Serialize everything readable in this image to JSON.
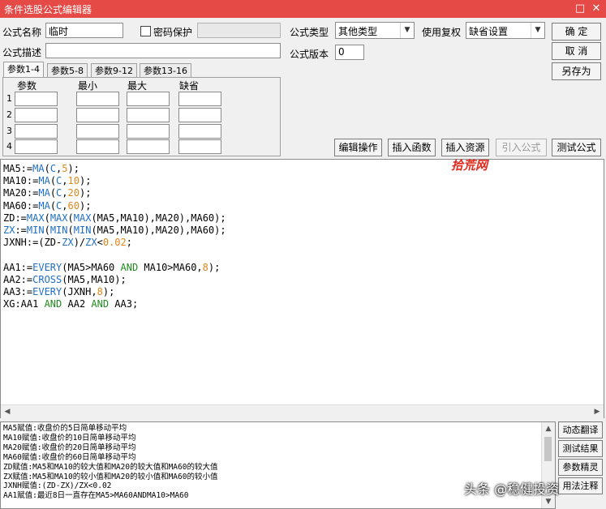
{
  "window": {
    "title": "条件选股公式编辑器",
    "min_icon": "□",
    "close_icon": "✕"
  },
  "form": {
    "name_label": "公式名称",
    "name_value": "临时",
    "password_label": "密码保护",
    "type_label": "公式类型",
    "type_value": "其他类型",
    "fq_label": "使用复权",
    "fq_value": "缺省设置",
    "desc_label": "公式描述",
    "desc_value": "",
    "version_label": "公式版本",
    "version_value": "0"
  },
  "right_buttons": {
    "ok": "确  定",
    "cancel": "取  消",
    "save_as": "另存为"
  },
  "tabs": [
    "参数1-4",
    "参数5-8",
    "参数9-12",
    "参数13-16"
  ],
  "param_headers": [
    "参数",
    "最小",
    "最大",
    "缺省"
  ],
  "param_rows": [
    "1",
    "2",
    "3",
    "4"
  ],
  "toolbar": {
    "edit_op": "编辑操作",
    "insert_func": "插入函数",
    "insert_res": "插入资源",
    "import_formula": "引入公式",
    "test_formula": "测试公式"
  },
  "watermark_top": "拾荒网",
  "code_lines": [
    "MA5:=MA(C,5);",
    "MA10:=MA(C,10);",
    "MA20:=MA(C,20);",
    "MA60:=MA(C,60);",
    "ZD:=MAX(MAX(MAX(MA5,MA10),MA20),MA60);",
    "ZX:=MIN(MIN(MIN(MA5,MA10),MA20),MA60);",
    "JXNH:=(ZD-ZX)/ZX<0.02;",
    "",
    "AA1:=EVERY(MA5>MA60 AND MA10>MA60,8);",
    "AA2:=CROSS(MA5,MA10);",
    "AA3:=EVERY(JXNH,8);",
    "XG:AA1 AND AA2 AND AA3;"
  ],
  "explain_lines": [
    "MA5赋值:收盘价的5日简单移动平均",
    "MA10赋值:收盘价的10日简单移动平均",
    "MA20赋值:收盘价的20日简单移动平均",
    "MA60赋值:收盘价的60日简单移动平均",
    "ZD赋值:MA5和MA10的较大值和MA20的较大值和MA60的较大值",
    "ZX赋值:MA5和MA10的较小值和MA20的较小值和MA60的较小值",
    "JXNH赋值:(ZD-ZX)/ZX<0.02",
    "AA1赋值:最近8日一直存在MA5>MA60ANDMA10>MA60"
  ],
  "side_buttons": {
    "translate": "动态翻译",
    "test_result": "测试结果",
    "param_tune": "参数精灵",
    "usage": "用法注释"
  },
  "footer_watermark": "头条 @稳健投资",
  "colors": {
    "titlebar": "#e64a46",
    "func": "#1f6fc5",
    "number": "#e0861a",
    "keyword": "#228b22"
  }
}
